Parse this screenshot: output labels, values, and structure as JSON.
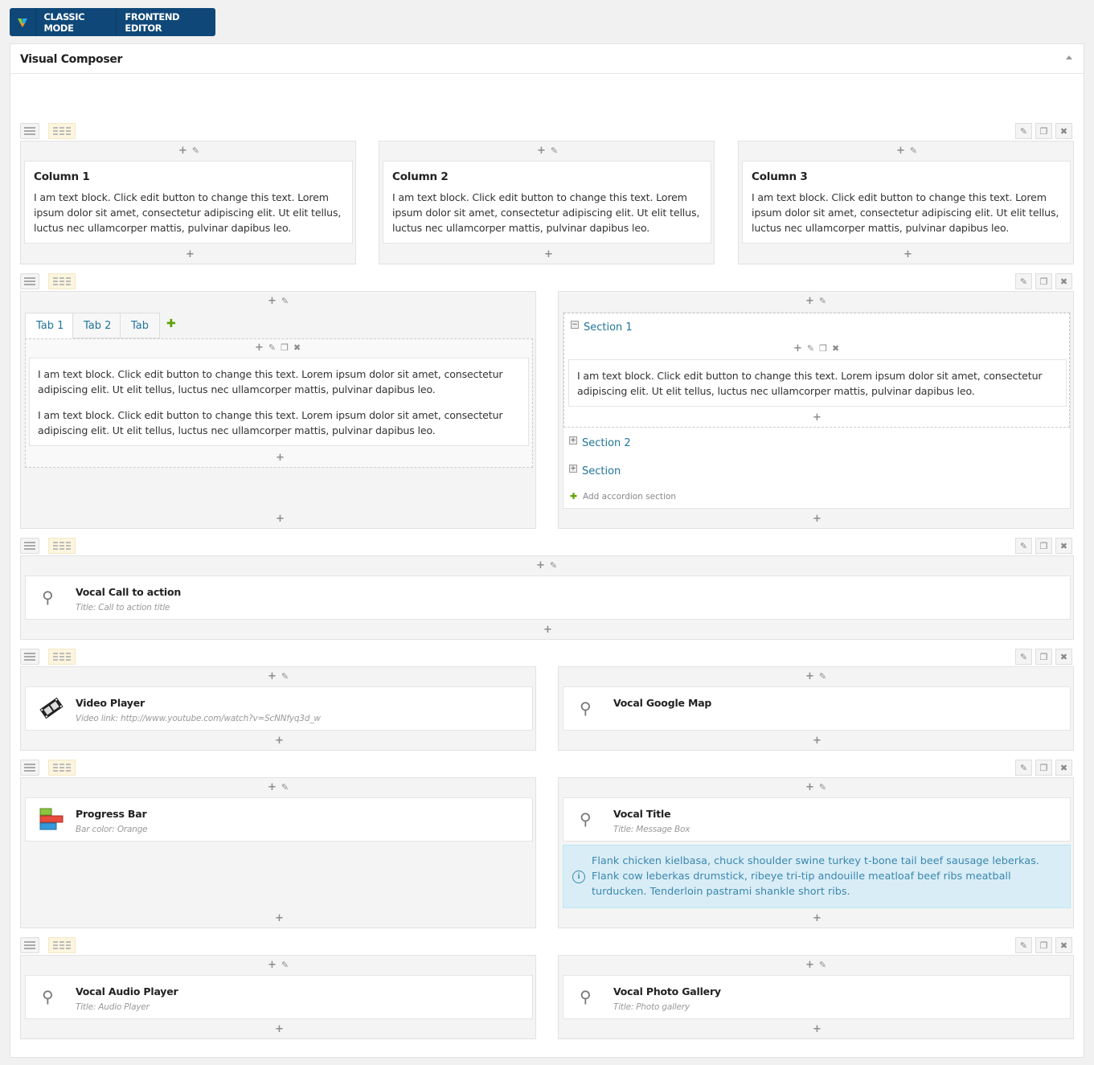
{
  "toolbar": {
    "logo_icon": "vc-logo-icon",
    "classic_mode": "CLASSIC MODE",
    "frontend_editor": "FRONTEND EDITOR"
  },
  "panel": {
    "title": "Visual Composer"
  },
  "row1": {
    "columns": [
      {
        "title": "Column 1",
        "text": "I am text block. Click edit button to change this text. Lorem ipsum dolor sit amet, consectetur adipiscing elit. Ut elit tellus, luctus nec ullamcorper mattis, pulvinar dapibus leo."
      },
      {
        "title": "Column 2",
        "text": "I am text block. Click edit button to change this text. Lorem ipsum dolor sit amet, consectetur adipiscing elit. Ut elit tellus, luctus nec ullamcorper mattis, pulvinar dapibus leo."
      },
      {
        "title": "Column 3",
        "text": "I am text block. Click edit button to change this text. Lorem ipsum dolor sit amet, consectetur adipiscing elit. Ut elit tellus, luctus nec ullamcorper mattis, pulvinar dapibus leo."
      }
    ]
  },
  "row2": {
    "tabs": [
      "Tab 1",
      "Tab 2",
      "Tab"
    ],
    "tab_text_1": "I am text block. Click edit button to change this text. Lorem ipsum dolor sit amet, consectetur adipiscing elit. Ut elit tellus, luctus nec ullamcorper mattis, pulvinar dapibus leo.",
    "tab_text_2": "I am text block. Click edit button to change this text. Lorem ipsum dolor sit amet, consectetur adipiscing elit. Ut elit tellus, luctus nec ullamcorper mattis, pulvinar dapibus leo.",
    "sections": [
      "Section 1",
      "Section 2",
      "Section"
    ],
    "section_text": "I am text block. Click edit button to change this text. Lorem ipsum dolor sit amet, consectetur adipiscing elit. Ut elit tellus, luctus nec ullamcorper mattis, pulvinar dapibus leo.",
    "add_section": "Add accordion section"
  },
  "row3": {
    "title": "Vocal Call to action",
    "sub": "Title: Call to action title"
  },
  "row4": {
    "left": {
      "title": "Video Player",
      "sub": "Video link: http://www.youtube.com/watch?v=ScNNfyq3d_w"
    },
    "right": {
      "title": "Vocal Google Map"
    }
  },
  "row5": {
    "left": {
      "title": "Progress Bar",
      "sub": "Bar color: Orange"
    },
    "right": {
      "title": "Vocal Title",
      "sub": "Title: Message Box"
    },
    "message": "Flank chicken kielbasa, chuck shoulder swine turkey t-bone tail beef sausage leberkas. Flank cow leberkas drumstick, ribeye tri-tip andouille meatloaf beef ribs meatball turducken. Tenderloin pastrami shankle short ribs."
  },
  "row6": {
    "left": {
      "title": "Vocal Audio Player",
      "sub": "Title: Audio Player"
    },
    "right": {
      "title": "Vocal Photo Gallery",
      "sub": "Title: Photo gallery"
    }
  },
  "colors": {
    "toolbar_bg": "#0f4878",
    "link": "#21759b",
    "info_bg": "#d9edf7",
    "info_text": "#3a87ad"
  }
}
